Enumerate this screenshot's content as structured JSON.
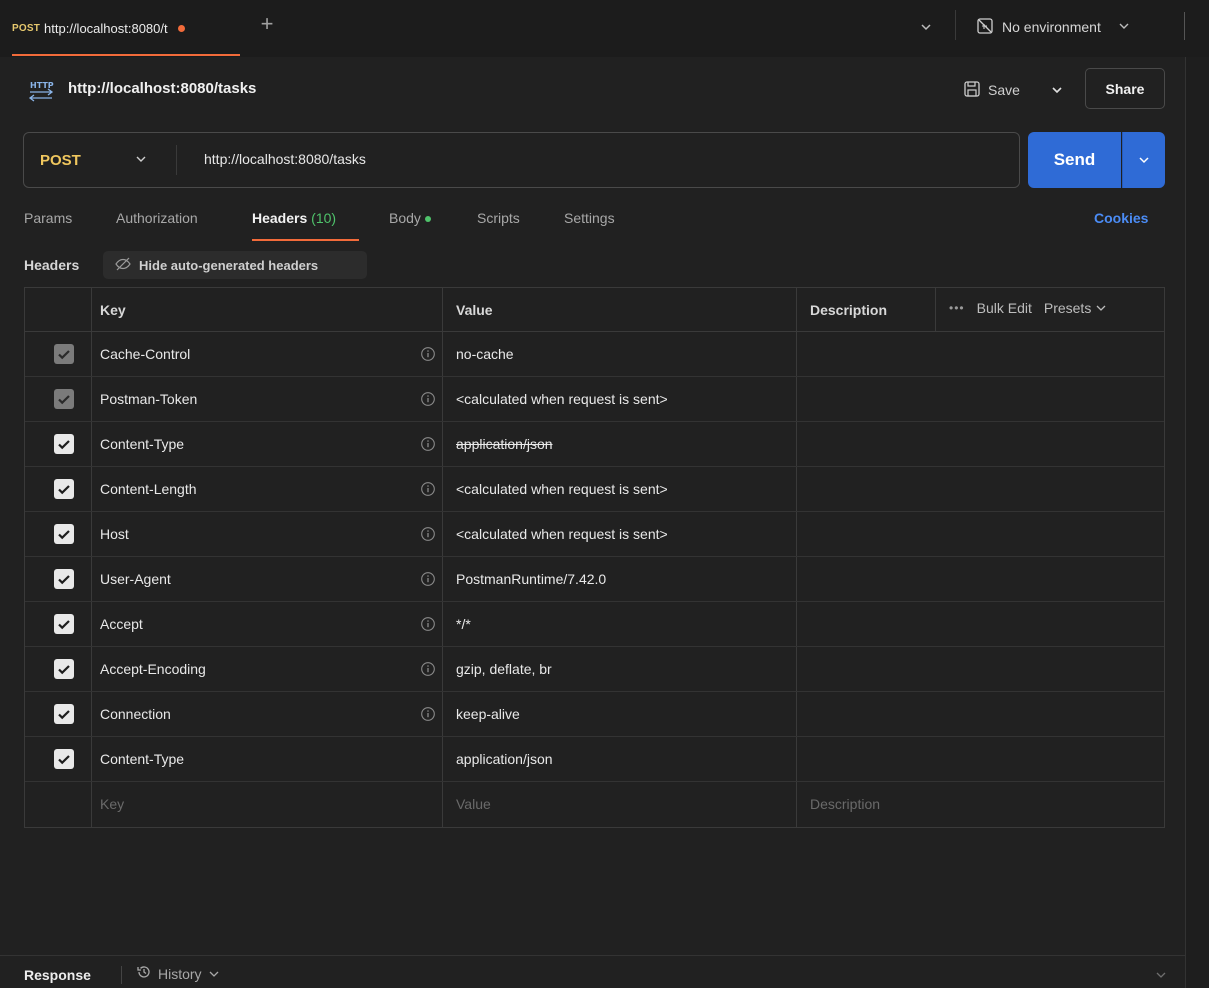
{
  "tab": {
    "method": "POST",
    "title": "http://localhost:8080/t",
    "unsaved_color": "#f26b3a"
  },
  "environment": {
    "label": "No environment"
  },
  "request": {
    "name": "http://localhost:8080/tasks",
    "method": "POST",
    "url": "http://localhost:8080/tasks"
  },
  "toolbar": {
    "save_label": "Save",
    "share_label": "Share",
    "send_label": "Send"
  },
  "request_tabs": {
    "params": "Params",
    "authorization": "Authorization",
    "headers": "Headers",
    "headers_count": "(10)",
    "body": "Body",
    "scripts": "Scripts",
    "settings": "Settings",
    "cookies": "Cookies"
  },
  "headers_section": {
    "label": "Headers",
    "hide_auto": "Hide auto-generated headers"
  },
  "table": {
    "columns": {
      "key": "Key",
      "value": "Value",
      "description": "Description"
    },
    "bulk_edit": "Bulk Edit",
    "presets": "Presets",
    "rows": [
      {
        "key": "Cache-Control",
        "value": "no-cache",
        "checked": "dim",
        "info": true,
        "strike": false
      },
      {
        "key": "Postman-Token",
        "value": "<calculated when request is sent>",
        "checked": "dim",
        "info": true,
        "strike": false
      },
      {
        "key": "Content-Type",
        "value": "application/json",
        "checked": "on",
        "info": true,
        "strike": true
      },
      {
        "key": "Content-Length",
        "value": "<calculated when request is sent>",
        "checked": "on",
        "info": true,
        "strike": false
      },
      {
        "key": "Host",
        "value": "<calculated when request is sent>",
        "checked": "on",
        "info": true,
        "strike": false
      },
      {
        "key": "User-Agent",
        "value": "PostmanRuntime/7.42.0",
        "checked": "on",
        "info": true,
        "strike": false
      },
      {
        "key": "Accept",
        "value": "*/*",
        "checked": "on",
        "info": true,
        "strike": false
      },
      {
        "key": "Accept-Encoding",
        "value": "gzip, deflate, br",
        "checked": "on",
        "info": true,
        "strike": false
      },
      {
        "key": "Connection",
        "value": "keep-alive",
        "checked": "on",
        "info": true,
        "strike": false
      },
      {
        "key": "Content-Type",
        "value": "application/json",
        "checked": "on",
        "info": false,
        "strike": false
      }
    ],
    "placeholder": {
      "key": "Key",
      "value": "Value",
      "description": "Description"
    }
  },
  "response_bar": {
    "label": "Response",
    "history": "History"
  },
  "colors": {
    "send": "#2f6bd6",
    "method": "#f0c75e",
    "active_tab": "#f26b3a",
    "count": "#4fc36b",
    "cookies": "#4b8cf5"
  }
}
